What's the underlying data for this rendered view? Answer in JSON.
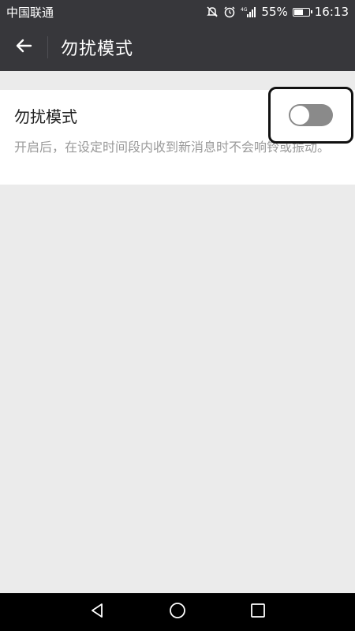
{
  "status_bar": {
    "carrier": "中国联通",
    "battery": "55%",
    "time": "16:13",
    "network": "4G"
  },
  "app_bar": {
    "title": "勿扰模式"
  },
  "setting": {
    "title": "勿扰模式",
    "description": "开启后，在设定时间段内收到新消息时不会响铃或振动。",
    "toggle_state": "off"
  },
  "colors": {
    "bar_bg": "#37373b",
    "page_bg": "#ebebeb",
    "toggle_off": "#8a8a8a"
  },
  "icons": {
    "back": "arrow-left-icon",
    "mute": "muted-bell-icon",
    "alarm": "alarm-clock-icon",
    "signal": "signal-icon",
    "battery": "battery-icon",
    "nav_back": "triangle-back-icon",
    "nav_home": "circle-home-icon",
    "nav_recent": "square-recent-icon"
  }
}
